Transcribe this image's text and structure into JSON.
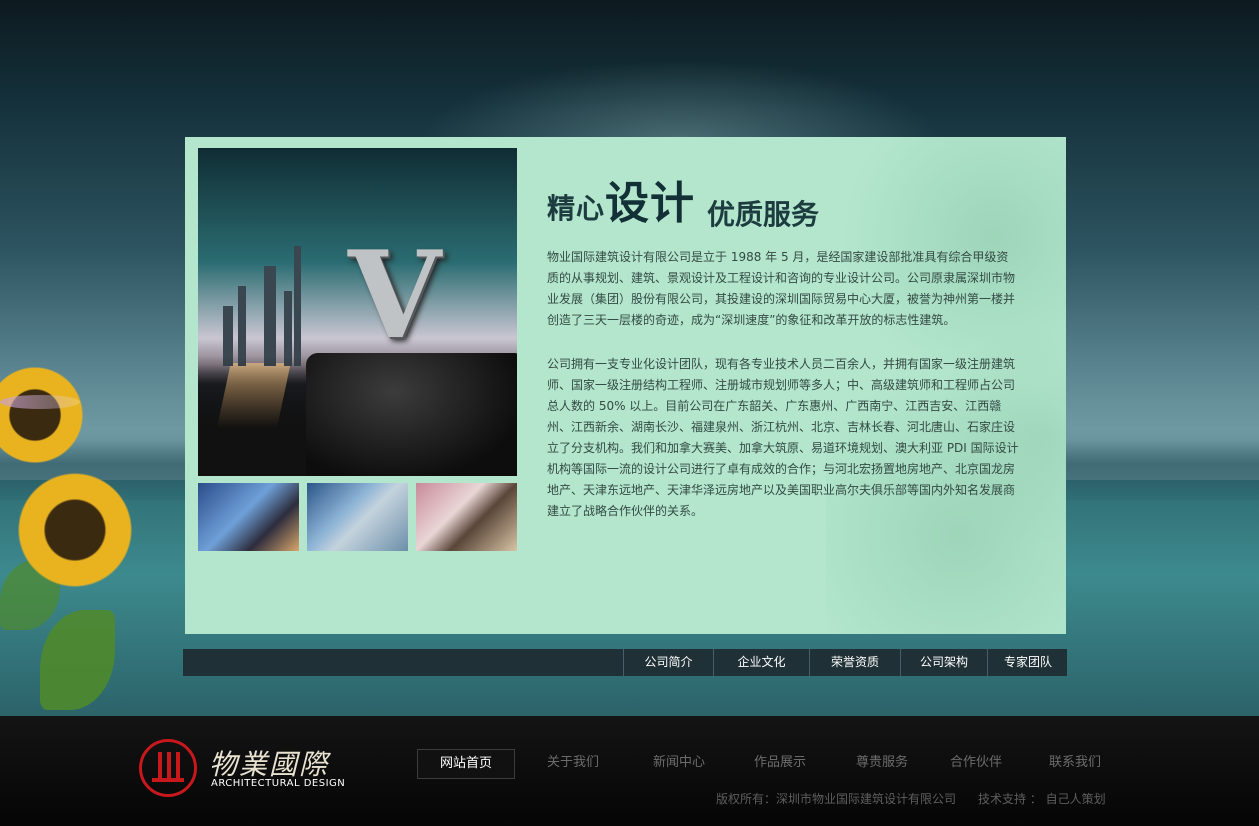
{
  "headline": {
    "part1_small": "精心",
    "part1_big": "设计",
    "part2": "优质服务"
  },
  "hero": {
    "letter": "V"
  },
  "content": {
    "paragraph1": "物业国际建筑设计有限公司是立于 1988 年 5 月，是经国家建设部批准具有综合甲级资质的从事规划、建筑、景观设计及工程设计和咨询的专业设计公司。公司原隶属深圳市物业发展（集团）股份有限公司，其投建设的深圳国际贸易中心大厦，被誉为神州第一楼并创造了三天一层楼的奇迹，成为“深圳速度”的象征和改革开放的标志性建筑。",
    "paragraph2": "公司拥有一支专业化设计团队，现有各专业技术人员二百余人，并拥有国家一级注册建筑师、国家一级注册结构工程师、注册城市规划师等多人；中、高级建筑师和工程师占公司总人数的 50% 以上。目前公司在广东韶关、广东惠州、广西南宁、江西吉安、江西赣州、江西新余、湖南长沙、福建泉州、浙江杭州、北京、吉林长春、河北唐山、石家庄设立了分支机构。我们和加拿大赛美、加拿大筑原、易道环境规划、澳大利亚 PDI 国际设计机构等国际一流的设计公司进行了卓有成效的合作；与河北宏扬置地房地产、北京国龙房地产、天津东远地产、天津华泽远房地产以及美国职业高尔夫俱乐部等国内外知名发展商建立了战略合作伙伴的关系。"
  },
  "subnav": {
    "items": [
      "公司简介",
      "企业文化",
      "荣誉资质",
      "公司架构",
      "专家团队"
    ]
  },
  "logo": {
    "cn": "物業國際",
    "en": "ARCHITECTURAL DESIGN"
  },
  "mainnav": {
    "items": [
      "网站首页",
      "关于我们",
      "新闻中心",
      "作品展示",
      "尊贵服务",
      "合作伙伴",
      "联系我们"
    ],
    "active_index": 0
  },
  "footer": {
    "copyright": "版权所有：深圳市物业国际建筑设计有限公司",
    "support": "技术支持 ： 自己人策划"
  },
  "colors": {
    "panel_bg": "#b3e6cd",
    "subnav_bg": "#1f3036",
    "footer_bg": "#0b0b0b",
    "logo_red": "#c8181c"
  }
}
